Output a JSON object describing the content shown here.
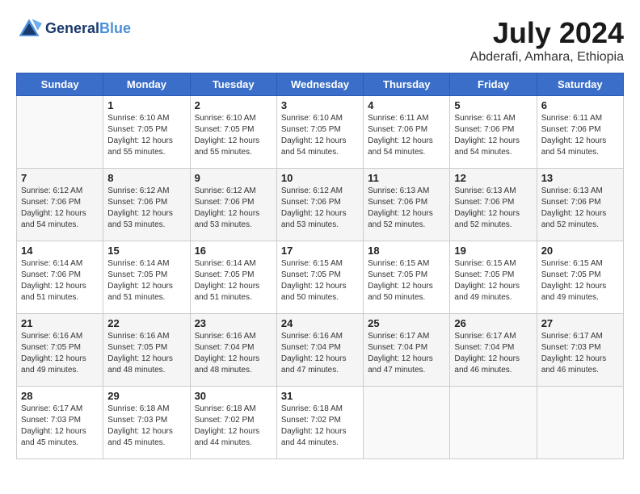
{
  "header": {
    "logo_line1": "General",
    "logo_line2": "Blue",
    "month": "July 2024",
    "location": "Abderafi, Amhara, Ethiopia"
  },
  "days_of_week": [
    "Sunday",
    "Monday",
    "Tuesday",
    "Wednesday",
    "Thursday",
    "Friday",
    "Saturday"
  ],
  "weeks": [
    [
      {
        "day": "",
        "info": ""
      },
      {
        "day": "1",
        "info": "Sunrise: 6:10 AM\nSunset: 7:05 PM\nDaylight: 12 hours\nand 55 minutes."
      },
      {
        "day": "2",
        "info": "Sunrise: 6:10 AM\nSunset: 7:05 PM\nDaylight: 12 hours\nand 55 minutes."
      },
      {
        "day": "3",
        "info": "Sunrise: 6:10 AM\nSunset: 7:05 PM\nDaylight: 12 hours\nand 54 minutes."
      },
      {
        "day": "4",
        "info": "Sunrise: 6:11 AM\nSunset: 7:06 PM\nDaylight: 12 hours\nand 54 minutes."
      },
      {
        "day": "5",
        "info": "Sunrise: 6:11 AM\nSunset: 7:06 PM\nDaylight: 12 hours\nand 54 minutes."
      },
      {
        "day": "6",
        "info": "Sunrise: 6:11 AM\nSunset: 7:06 PM\nDaylight: 12 hours\nand 54 minutes."
      }
    ],
    [
      {
        "day": "7",
        "info": "Sunrise: 6:12 AM\nSunset: 7:06 PM\nDaylight: 12 hours\nand 54 minutes."
      },
      {
        "day": "8",
        "info": "Sunrise: 6:12 AM\nSunset: 7:06 PM\nDaylight: 12 hours\nand 53 minutes."
      },
      {
        "day": "9",
        "info": "Sunrise: 6:12 AM\nSunset: 7:06 PM\nDaylight: 12 hours\nand 53 minutes."
      },
      {
        "day": "10",
        "info": "Sunrise: 6:12 AM\nSunset: 7:06 PM\nDaylight: 12 hours\nand 53 minutes."
      },
      {
        "day": "11",
        "info": "Sunrise: 6:13 AM\nSunset: 7:06 PM\nDaylight: 12 hours\nand 52 minutes."
      },
      {
        "day": "12",
        "info": "Sunrise: 6:13 AM\nSunset: 7:06 PM\nDaylight: 12 hours\nand 52 minutes."
      },
      {
        "day": "13",
        "info": "Sunrise: 6:13 AM\nSunset: 7:06 PM\nDaylight: 12 hours\nand 52 minutes."
      }
    ],
    [
      {
        "day": "14",
        "info": "Sunrise: 6:14 AM\nSunset: 7:06 PM\nDaylight: 12 hours\nand 51 minutes."
      },
      {
        "day": "15",
        "info": "Sunrise: 6:14 AM\nSunset: 7:05 PM\nDaylight: 12 hours\nand 51 minutes."
      },
      {
        "day": "16",
        "info": "Sunrise: 6:14 AM\nSunset: 7:05 PM\nDaylight: 12 hours\nand 51 minutes."
      },
      {
        "day": "17",
        "info": "Sunrise: 6:15 AM\nSunset: 7:05 PM\nDaylight: 12 hours\nand 50 minutes."
      },
      {
        "day": "18",
        "info": "Sunrise: 6:15 AM\nSunset: 7:05 PM\nDaylight: 12 hours\nand 50 minutes."
      },
      {
        "day": "19",
        "info": "Sunrise: 6:15 AM\nSunset: 7:05 PM\nDaylight: 12 hours\nand 49 minutes."
      },
      {
        "day": "20",
        "info": "Sunrise: 6:15 AM\nSunset: 7:05 PM\nDaylight: 12 hours\nand 49 minutes."
      }
    ],
    [
      {
        "day": "21",
        "info": "Sunrise: 6:16 AM\nSunset: 7:05 PM\nDaylight: 12 hours\nand 49 minutes."
      },
      {
        "day": "22",
        "info": "Sunrise: 6:16 AM\nSunset: 7:05 PM\nDaylight: 12 hours\nand 48 minutes."
      },
      {
        "day": "23",
        "info": "Sunrise: 6:16 AM\nSunset: 7:04 PM\nDaylight: 12 hours\nand 48 minutes."
      },
      {
        "day": "24",
        "info": "Sunrise: 6:16 AM\nSunset: 7:04 PM\nDaylight: 12 hours\nand 47 minutes."
      },
      {
        "day": "25",
        "info": "Sunrise: 6:17 AM\nSunset: 7:04 PM\nDaylight: 12 hours\nand 47 minutes."
      },
      {
        "day": "26",
        "info": "Sunrise: 6:17 AM\nSunset: 7:04 PM\nDaylight: 12 hours\nand 46 minutes."
      },
      {
        "day": "27",
        "info": "Sunrise: 6:17 AM\nSunset: 7:03 PM\nDaylight: 12 hours\nand 46 minutes."
      }
    ],
    [
      {
        "day": "28",
        "info": "Sunrise: 6:17 AM\nSunset: 7:03 PM\nDaylight: 12 hours\nand 45 minutes."
      },
      {
        "day": "29",
        "info": "Sunrise: 6:18 AM\nSunset: 7:03 PM\nDaylight: 12 hours\nand 45 minutes."
      },
      {
        "day": "30",
        "info": "Sunrise: 6:18 AM\nSunset: 7:02 PM\nDaylight: 12 hours\nand 44 minutes."
      },
      {
        "day": "31",
        "info": "Sunrise: 6:18 AM\nSunset: 7:02 PM\nDaylight: 12 hours\nand 44 minutes."
      },
      {
        "day": "",
        "info": ""
      },
      {
        "day": "",
        "info": ""
      },
      {
        "day": "",
        "info": ""
      }
    ]
  ]
}
